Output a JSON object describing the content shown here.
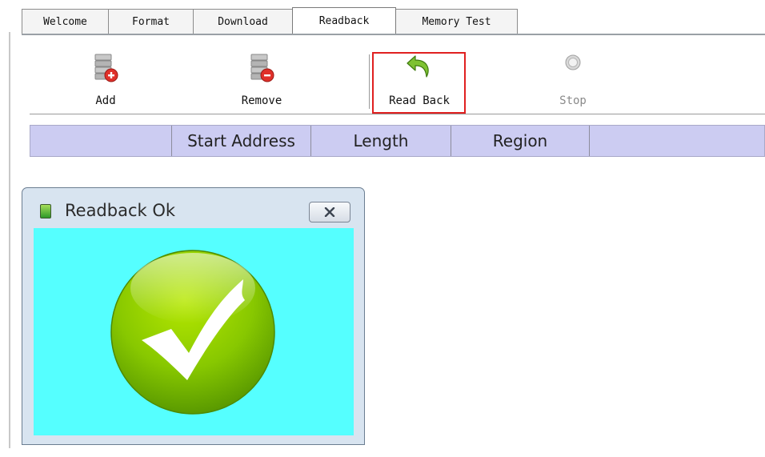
{
  "tabs": [
    {
      "id": "welcome",
      "label": "Welcome",
      "active": false
    },
    {
      "id": "format",
      "label": "Format",
      "active": false
    },
    {
      "id": "download",
      "label": "Download",
      "active": false
    },
    {
      "id": "readback",
      "label": "Readback",
      "active": true
    },
    {
      "id": "memory-test",
      "label": "Memory Test",
      "active": false
    }
  ],
  "toolbar": {
    "add_label": "Add",
    "remove_label": "Remove",
    "readback_label": "Read Back",
    "stop_label": "Stop",
    "stop_enabled": false,
    "highlighted": "Read Back"
  },
  "table": {
    "columns": [
      "",
      "Start Address",
      "Length",
      "Region",
      ""
    ]
  },
  "dialog": {
    "title": "Readback Ok",
    "status_icon": "green-checkmark-icon",
    "colors": {
      "client_background": "#55ffff",
      "badge": "#7fc400"
    }
  },
  "colors": {
    "table_header": "#ccccf2",
    "highlight_border": "#e02020"
  }
}
